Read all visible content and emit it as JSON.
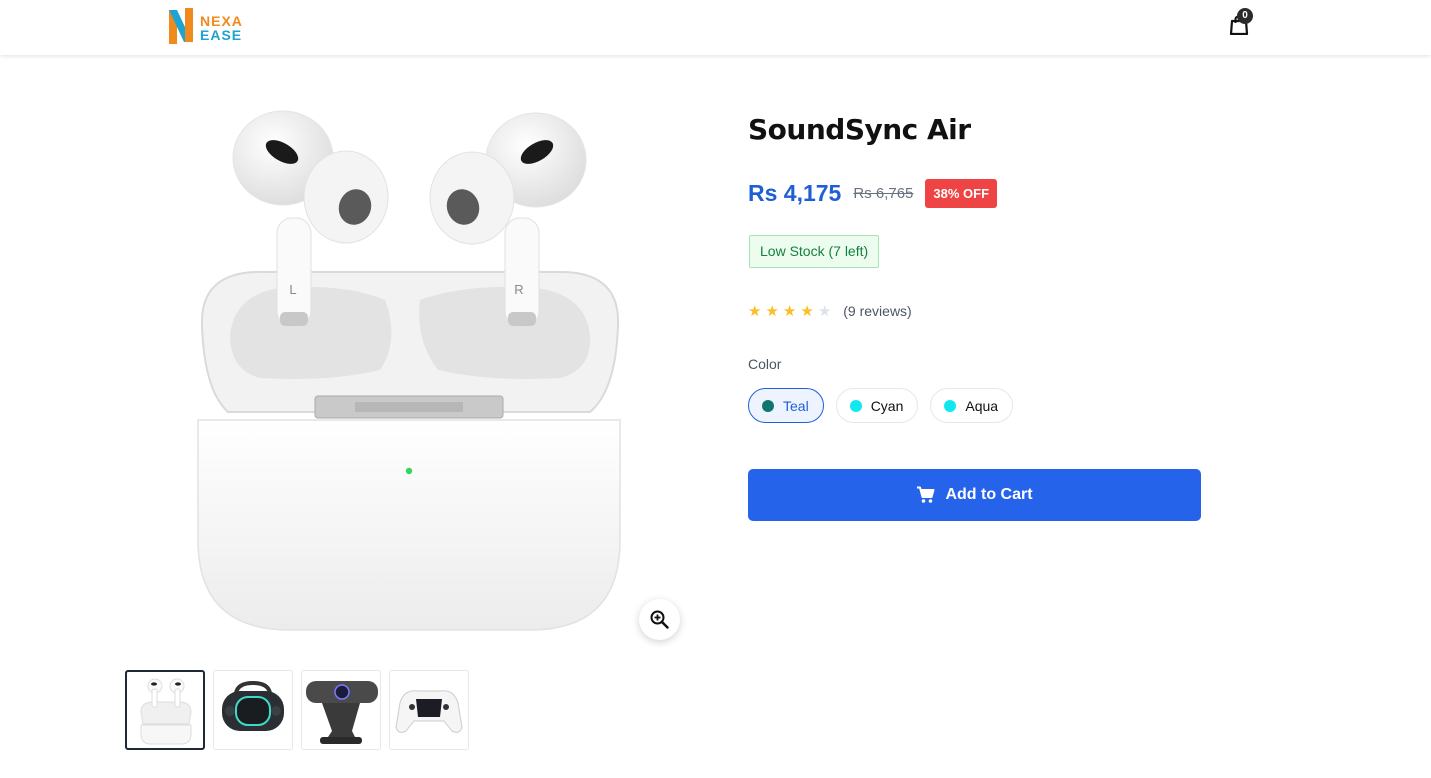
{
  "header": {
    "logo_top": "NEXA",
    "logo_bottom": "EASE",
    "cart_count": "0"
  },
  "product": {
    "title": "SoundSync Air",
    "price": "Rs 4,175",
    "old_price": "Rs 6,765",
    "discount": "38% OFF",
    "stock": "Low Stock (7 left)",
    "rating": 4,
    "rating_max": 5,
    "reviews": "(9 reviews)",
    "color_label": "Color",
    "colors": [
      {
        "name": "Teal",
        "hex": "#0f766e",
        "selected": true
      },
      {
        "name": "Cyan",
        "hex": "#10e8f0",
        "selected": false
      },
      {
        "name": "Aqua",
        "hex": "#10e8f0",
        "selected": false
      }
    ],
    "add_to_cart": "Add to Cart"
  },
  "gallery": {
    "thumbnails": [
      "earbuds-thumbnail",
      "speaker-thumbnail",
      "webcam-thumbnail",
      "gamepad-thumbnail"
    ],
    "active_index": 0
  },
  "theme": {
    "accent": "#2563eb",
    "price_color": "#1f5fd6",
    "discount_color": "#ef4444",
    "stock_color": "#15803d"
  }
}
